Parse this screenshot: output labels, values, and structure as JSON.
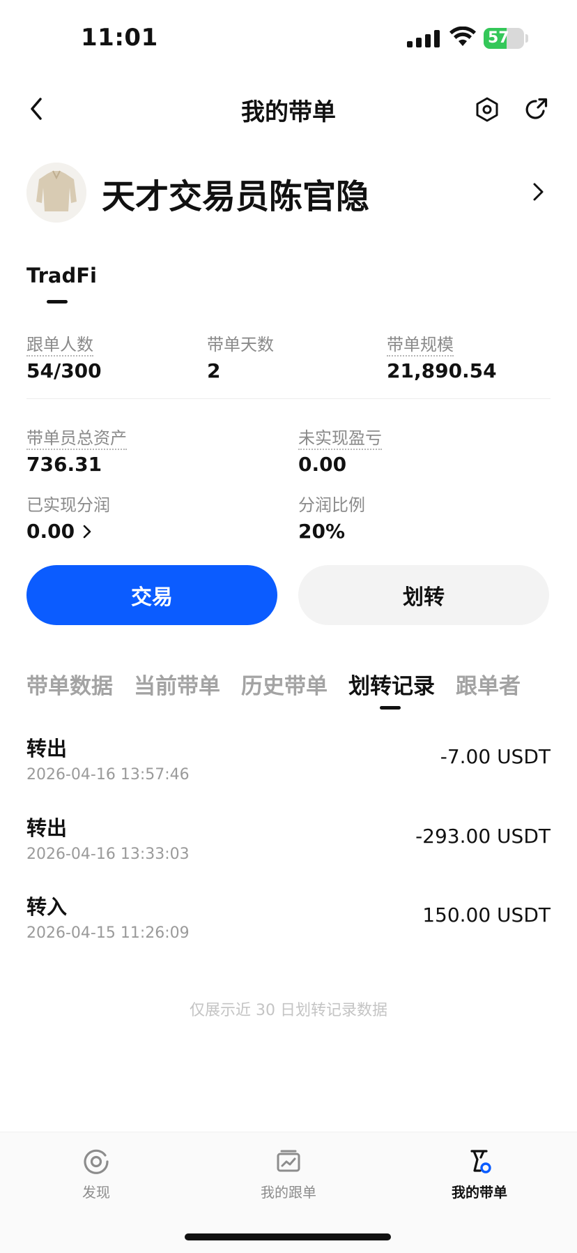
{
  "status_bar": {
    "time": "11:01",
    "battery": "57",
    "battery_level": 0.57
  },
  "header": {
    "title": "我的带单"
  },
  "profile": {
    "name": "天才交易员陈官隐"
  },
  "category": {
    "label": "TradFi"
  },
  "stats_row1": [
    {
      "label": "跟单人数",
      "value": "54/300"
    },
    {
      "label": "带单天数",
      "value": "2"
    },
    {
      "label": "带单规模",
      "value": "21,890.54"
    }
  ],
  "stats_row2": [
    {
      "label": "带单员总资产",
      "value": "736.31"
    },
    {
      "label": "未实现盈亏",
      "value": "0.00"
    }
  ],
  "stats_row3": [
    {
      "label": "已实现分润",
      "value": "0.00"
    },
    {
      "label": "分润比例",
      "value": "20%"
    }
  ],
  "buttons": {
    "trade": "交易",
    "transfer": "划转"
  },
  "tabs": [
    {
      "label": "带单数据",
      "active": false
    },
    {
      "label": "当前带单",
      "active": false
    },
    {
      "label": "历史带单",
      "active": false
    },
    {
      "label": "划转记录",
      "active": true
    },
    {
      "label": "跟单者",
      "active": false
    }
  ],
  "records": [
    {
      "type": "转出",
      "time": "2026-04-16 13:57:46",
      "amount": "-7.00 USDT"
    },
    {
      "type": "转出",
      "time": "2026-04-16 13:33:03",
      "amount": "-293.00 USDT"
    },
    {
      "type": "转入",
      "time": "2026-04-15 11:26:09",
      "amount": "150.00 USDT"
    }
  ],
  "note": "仅展示近 30 日划转记录数据",
  "bottom_nav": [
    {
      "label": "发现",
      "icon": "discover-icon",
      "active": false
    },
    {
      "label": "我的跟单",
      "icon": "chart-icon",
      "active": false
    },
    {
      "label": "我的带单",
      "icon": "lead-trade-icon",
      "active": true
    }
  ],
  "colors": {
    "accent": "#0b5cff",
    "battery_green": "#34c759"
  }
}
